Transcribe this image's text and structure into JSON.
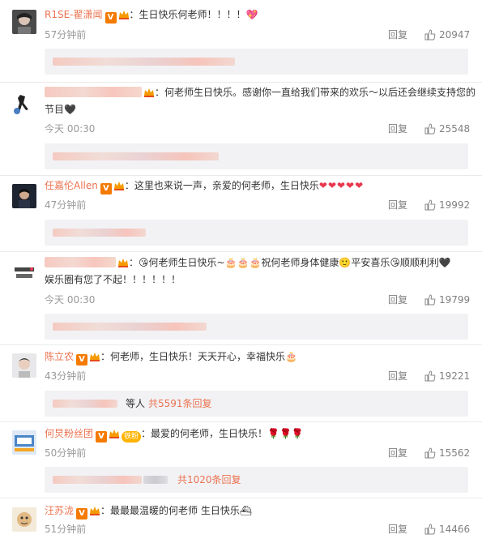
{
  "colors": {
    "accent": "#eb7350",
    "link": "#eb7350",
    "muted": "#999999",
    "heart": "#e8374e"
  },
  "comments": [
    {
      "user": "R1SE-翟潇闻",
      "text": "：生日快乐何老师！！！！",
      "emoji": "💖",
      "time": "57分钟前",
      "reply_label": "回复",
      "likes": "20947"
    },
    {
      "user": "",
      "text": "：何老师生日快乐。感谢你一直给我们带来的欢乐～以后还会继续支持您的",
      "text2": "节目🖤",
      "time": "今天 00:30",
      "reply_label": "回复",
      "likes": "25548"
    },
    {
      "user": "任嘉伦Allen",
      "text": "：这里也来说一声，亲爱的何老师，生日快乐",
      "emoji": "❤❤❤❤❤",
      "time": "47分钟前",
      "reply_label": "回复",
      "likes": "19992"
    },
    {
      "user": "",
      "text": "：😘何老师生日快乐~🎂🎂🎂祝何老师身体健康🙂平安喜乐😘顺顺利利🖤",
      "text2": "娱乐圈有您了不起！！！！！！",
      "time": "今天 00:30",
      "reply_label": "回复",
      "likes": "19799"
    },
    {
      "user": "陈立农",
      "text": "：何老师，生日快乐！天天开心，幸福快乐",
      "emoji": "🎂",
      "time": "43分钟前",
      "reply_label": "回复",
      "likes": "19221",
      "sub_suffix": "等人",
      "sub_more": "共5591条回复"
    },
    {
      "user": "何炅粉丝团",
      "fan_badge": "铁粉",
      "text": "：最爱的何老师，生日快乐！",
      "emoji": "🌹🌹🌹",
      "time": "50分钟前",
      "reply_label": "回复",
      "likes": "15562",
      "sub_more": "共1020条回复"
    },
    {
      "user": "汪苏泷",
      "text": "：最最最温暖的何老师 生日快乐",
      "emoji": "⛴",
      "time": "51分钟前",
      "reply_label": "回复",
      "likes": "14466"
    }
  ]
}
